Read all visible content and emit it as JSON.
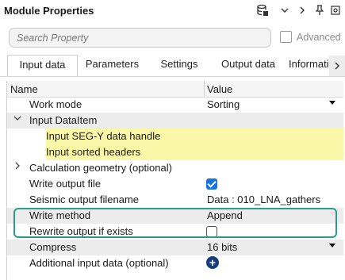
{
  "window": {
    "title": "Module Properties",
    "buttons": [
      "database-icon",
      "chevron-down-icon",
      "chevron-right-icon",
      "pin-icon",
      "settings-icon"
    ]
  },
  "search": {
    "placeholder": "Search Property",
    "value": ""
  },
  "advanced": {
    "label": "Advanced",
    "checked": false
  },
  "tabs": [
    {
      "label": "Input data",
      "active": true
    },
    {
      "label": "Parameters",
      "active": false
    },
    {
      "label": "Settings",
      "active": false
    },
    {
      "label": "Output data",
      "active": false
    },
    {
      "label": "Informatio",
      "active": false
    }
  ],
  "grid": {
    "columns": [
      "Name",
      "Value"
    ],
    "rows": {
      "work_mode": {
        "name": "Work mode",
        "value": "Sorting"
      },
      "input_dataitem": {
        "name": "Input DataItem",
        "expanded": true
      },
      "seg_y_handle": {
        "name": "Input SEG-Y data handle"
      },
      "sorted_headers": {
        "name": "Input sorted headers"
      },
      "calc_geometry": {
        "name": "Calculation geometry (optional)",
        "expanded": false
      },
      "write_output": {
        "name": "Write output file",
        "checked": true
      },
      "seismic_filename": {
        "name": "Seismic output filename",
        "value": "Data : 010_LNA_gathers"
      },
      "write_method": {
        "name": "Write method",
        "value": "Append"
      },
      "rewrite": {
        "name": "Rewrite output if exists",
        "checked": false
      },
      "compress": {
        "name": "Compress",
        "value": "16 bits"
      },
      "additional": {
        "name": "Additional input data (optional)"
      }
    }
  },
  "colors": {
    "highlight": "#fbf7a8",
    "checkbox_on": "#1a73d9",
    "annotation_box": "#2a9d8a"
  }
}
